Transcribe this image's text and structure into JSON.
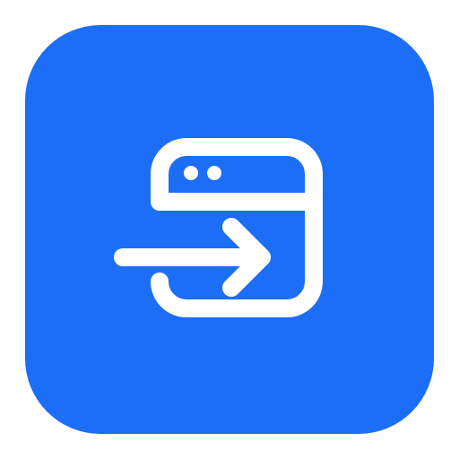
{
  "app_icon": {
    "icon": "browser-login-arrow-icon",
    "background_color": "#1d6ef7",
    "glyph_color": "#ffffff"
  }
}
